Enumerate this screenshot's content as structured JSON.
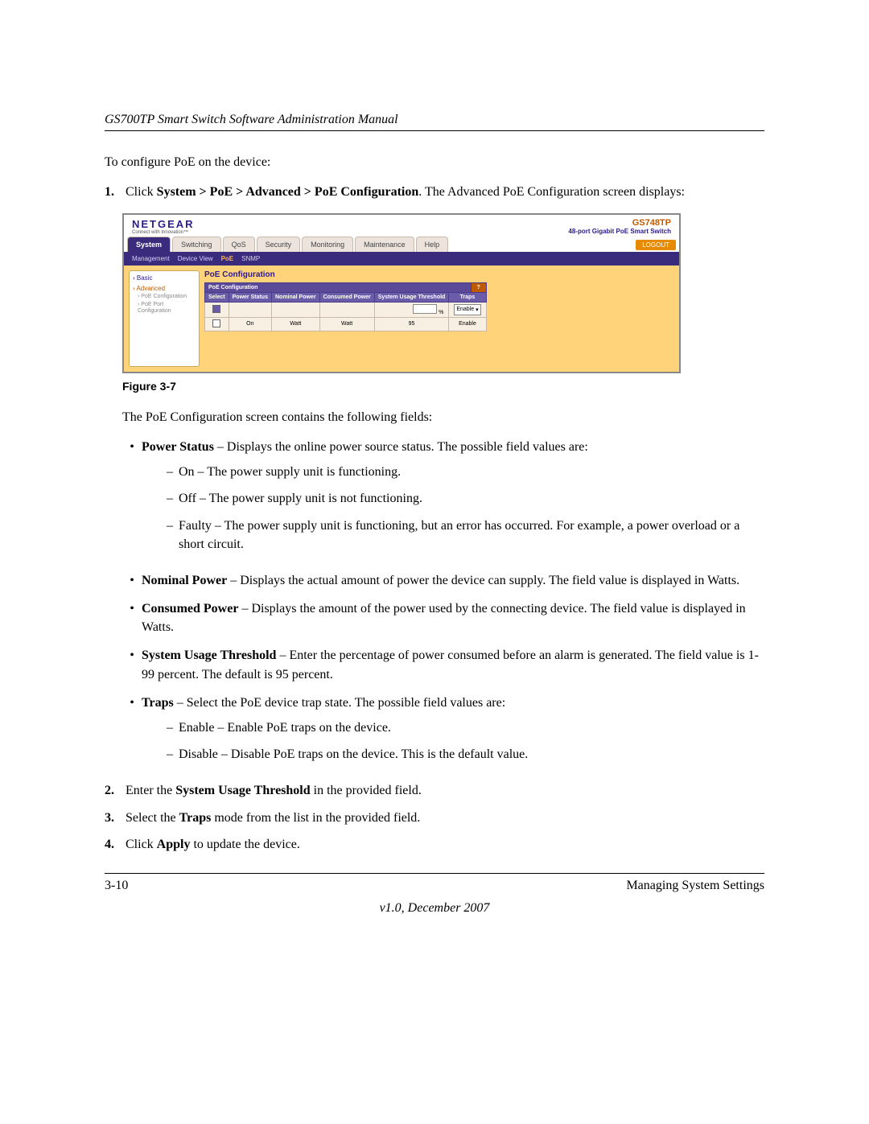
{
  "header": "GS700TP Smart Switch Software Administration Manual",
  "intro": "To configure PoE on the device:",
  "steps": {
    "s1_num": "1.",
    "s1_a": "Click ",
    "s1_b": "System > PoE > Advanced > PoE Configuration",
    "s1_c": ". The Advanced PoE Configuration screen displays:",
    "s2_num": "2.",
    "s2_a": "Enter the ",
    "s2_b": "System Usage Threshold",
    "s2_c": " in the provided field.",
    "s3_num": "3.",
    "s3_a": "Select the ",
    "s3_b": "Traps",
    "s3_c": " mode from the list in the provided field.",
    "s4_num": "4.",
    "s4_a": "Click ",
    "s4_b": "Apply",
    "s4_c": " to update the device."
  },
  "screenshot": {
    "logo": "NETGEAR",
    "tagline": "Connect with Innovation™",
    "model": "GS748TP",
    "model_sub": "48-port Gigabit PoE Smart Switch",
    "tabs": [
      "System",
      "Switching",
      "QoS",
      "Security",
      "Monitoring",
      "Maintenance",
      "Help"
    ],
    "logout": "LOGOUT",
    "subtabs": [
      "Management",
      "Device View",
      "PoE",
      "SNMP"
    ],
    "sidenav": {
      "basic": "› Basic",
      "advanced": "› Advanced",
      "leaf1": "› PoE Configuration",
      "leaf2": "› PoE Port Configuration"
    },
    "panel_title": "PoE Configuration",
    "panel_sub": "PoE Configuration",
    "cols": [
      "Select",
      "Power Status",
      "Nominal Power",
      "Consumed Power",
      "System Usage Threshold",
      "Traps"
    ],
    "row_suffix": "%",
    "traps_sel": "Enable",
    "data_row": {
      "status": "On",
      "nominal": "Watt",
      "consumed": "Watt",
      "threshold": "95",
      "traps": "Enable"
    }
  },
  "fig_label": "Figure 3-7",
  "after_fig": "The PoE Configuration screen contains the following fields:",
  "bullets": {
    "b1_t": "Power Status",
    "b1_r": " – Displays the online power source status. The possible field values are:",
    "b1_s1": "On – The power supply unit is functioning.",
    "b1_s2": "Off – The power supply unit is not functioning.",
    "b1_s3": "Faulty – The power supply unit is functioning, but an error has occurred. For example, a power overload or a short circuit.",
    "b2_t": "Nominal Power",
    "b2_r": " – Displays the actual amount of power the device can supply. The field value is displayed in Watts.",
    "b3_t": "Consumed Power",
    "b3_r": " – Displays the amount of the power used by the connecting device. The field value is displayed in Watts.",
    "b4_t": "System Usage Threshold",
    "b4_r": " – Enter the percentage of power consumed before an alarm is generated. The field value is 1-99 percent. The default is 95 percent.",
    "b5_t": "Traps",
    "b5_r": " – Select the PoE device trap state. The possible field values are:",
    "b5_s1": "Enable – Enable PoE traps on the device.",
    "b5_s2": "Disable – Disable PoE traps on the device. This is the default value."
  },
  "footer": {
    "page": "3-10",
    "section": "Managing System Settings",
    "version": "v1.0, December 2007"
  }
}
